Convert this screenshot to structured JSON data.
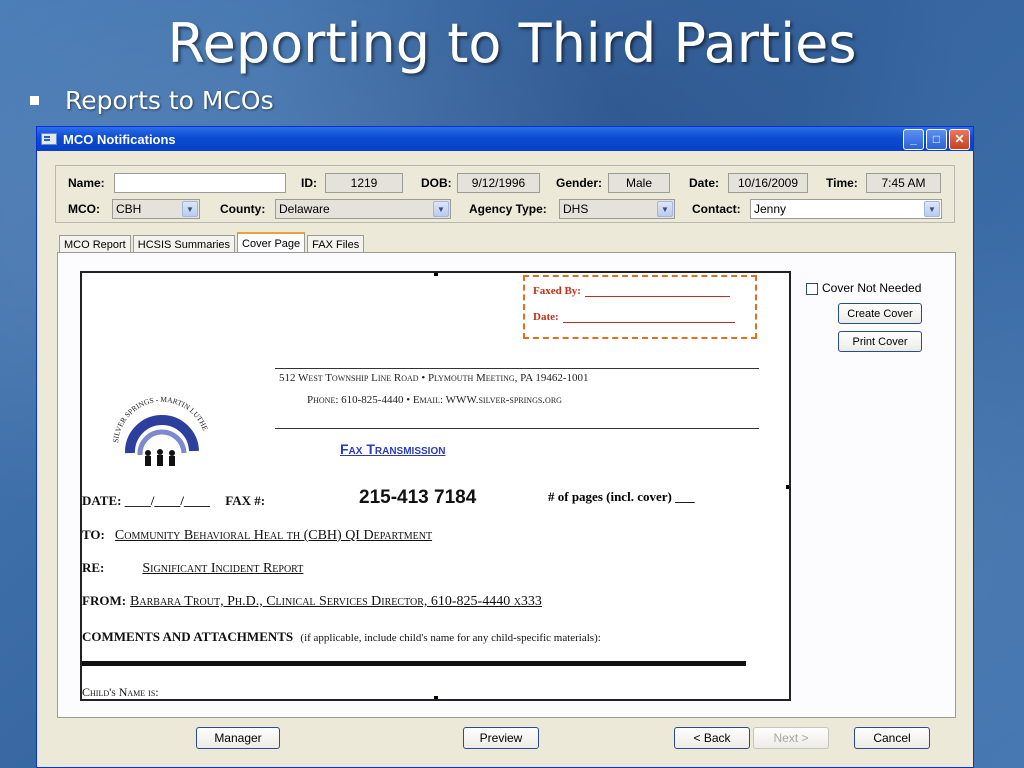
{
  "slide": {
    "title": "Reporting to Third Parties",
    "bullet": "Reports to MCOs"
  },
  "window": {
    "title": "MCO Notifications"
  },
  "form": {
    "name_label": "Name:",
    "name_value": "",
    "id_label": "ID:",
    "id_value": "1219",
    "dob_label": "DOB:",
    "dob_value": "9/12/1996",
    "gender_label": "Gender:",
    "gender_value": "Male",
    "date_label": "Date:",
    "date_value": "10/16/2009",
    "time_label": "Time:",
    "time_value": "7:45 AM",
    "mco_label": "MCO:",
    "mco_value": "CBH",
    "county_label": "County:",
    "county_value": "Delaware",
    "agency_label": "Agency Type:",
    "agency_value": "DHS",
    "contact_label": "Contact:",
    "contact_value": "Jenny"
  },
  "tabs": [
    {
      "label": "MCO Report"
    },
    {
      "label": "HCSIS Summaries"
    },
    {
      "label": "Cover Page"
    },
    {
      "label": "FAX Files"
    }
  ],
  "document": {
    "faxed_by": "Faxed By:",
    "date_label": "Date:",
    "logo_text": "SILVER SPRINGS - MARTIN LUTHER SCHOOL",
    "address": "512 West Township Line Road  •  Plymouth Meeting, PA 19462-1001",
    "phone": "Phone: 610-825-4440  •  Email:  WWW.silver-springs.org",
    "fax_title": "Fax Transmission",
    "date_line": "DATE: ____/____/____",
    "fax_label": "FAX #:",
    "fax_number": "215-413 7184",
    "pages": "# of pages (incl. cover) ___",
    "to_label": "TO:",
    "to_value": "Community Behavioral Heal th (CBH)  QI Department",
    "re_label": "RE:",
    "re_value": "Significant Incident Report",
    "from_label": "FROM:",
    "from_value": "Barbara Trout, Ph.D., Clinical Services Director, 610-825-4440 x333",
    "comments_label": "COMMENTS AND ATTACHMENTS",
    "comments_note": "(if applicable, include child's name for any child-specific materials):",
    "child_name": "Child's Name is:"
  },
  "options": {
    "cover_not_needed": "Cover Not Needed",
    "create_cover": "Create Cover",
    "print_cover": "Print Cover"
  },
  "buttons": {
    "manager": "Manager",
    "preview": "Preview",
    "back": "< Back",
    "next": "Next >",
    "cancel": "Cancel"
  }
}
